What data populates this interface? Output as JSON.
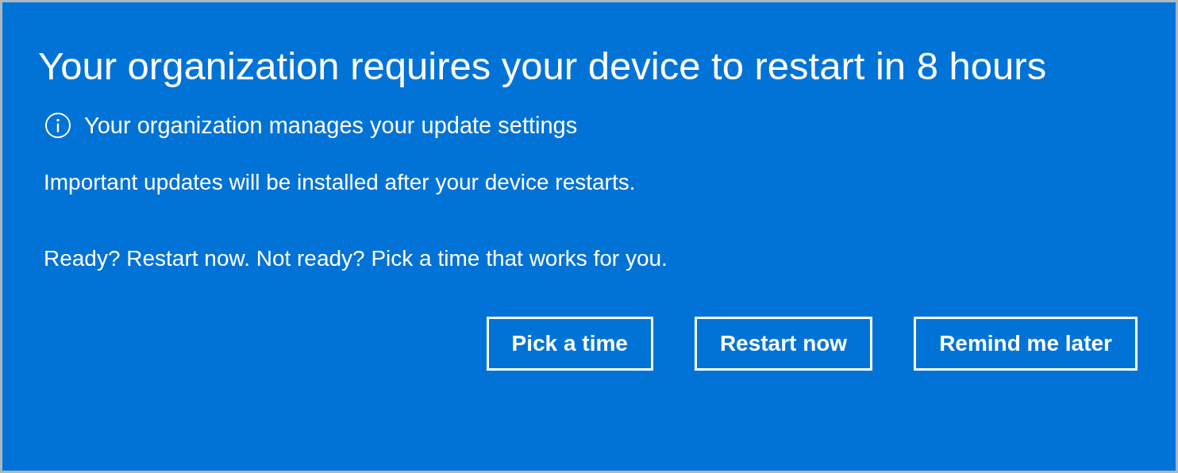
{
  "title": "Your organization requires your device to restart in 8 hours",
  "notice": "Your organization manages your update settings",
  "paragraphs": [
    "Important updates will be installed after your device restarts.",
    "Ready? Restart now. Not ready? Pick a time that works for you."
  ],
  "buttons": [
    "Pick a time",
    "Restart now",
    "Remind me later"
  ]
}
